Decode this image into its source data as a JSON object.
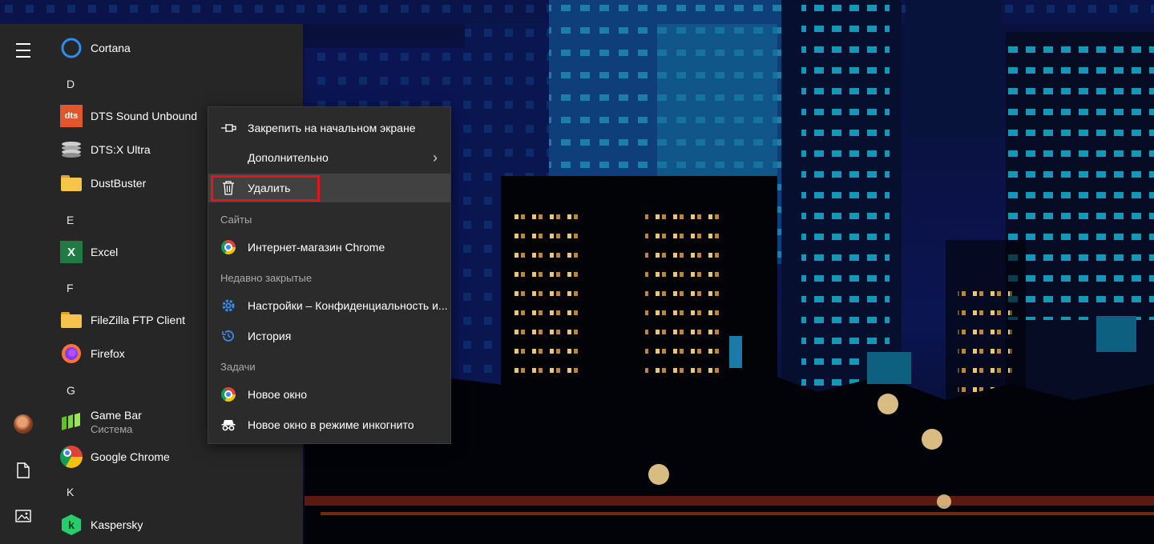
{
  "start_menu": {
    "apps": [
      {
        "label": "Cortana",
        "icon": "cortana-icon"
      },
      {
        "label": "DTS Sound Unbound",
        "icon": "dts-icon",
        "icon_text": "dts"
      },
      {
        "label": "DTS:X Ultra",
        "icon": "dtsx-icon"
      },
      {
        "label": "DustBuster",
        "icon": "folder-icon"
      },
      {
        "label": "Excel",
        "icon": "excel-icon",
        "icon_text": "X"
      },
      {
        "label": "FileZilla FTP Client",
        "icon": "folder-icon"
      },
      {
        "label": "Firefox",
        "icon": "firefox-icon"
      },
      {
        "label": "Game Bar",
        "sublabel": "Система",
        "icon": "game-bar-icon"
      },
      {
        "label": "Google Chrome",
        "icon": "chrome-icon"
      },
      {
        "label": "Kaspersky",
        "icon": "kaspersky-icon",
        "icon_text": "k"
      }
    ],
    "letters": [
      "D",
      "E",
      "F",
      "G",
      "K"
    ],
    "rail_icons": [
      "hamburger-icon",
      "avatar",
      "document-icon",
      "pictures-icon"
    ]
  },
  "context_menu": {
    "pin_label": "Закрепить на начальном экране",
    "more_label": "Дополнительно",
    "more_arrow": "›",
    "delete_label": "Удалить",
    "sites_header": "Сайты",
    "chrome_store_label": "Интернет-магазин Chrome",
    "recent_header": "Недавно закрытые",
    "settings_label": "Настройки – Конфиденциальность и...",
    "history_label": "История",
    "tasks_header": "Задачи",
    "new_window_label": "Новое окно",
    "incognito_label": "Новое окно в режиме инкогнито"
  },
  "colors": {
    "menu_bg": "#262626",
    "context_bg": "#2b2b2b",
    "highlight": "#e2141c",
    "accent": "#2d8cf0"
  }
}
